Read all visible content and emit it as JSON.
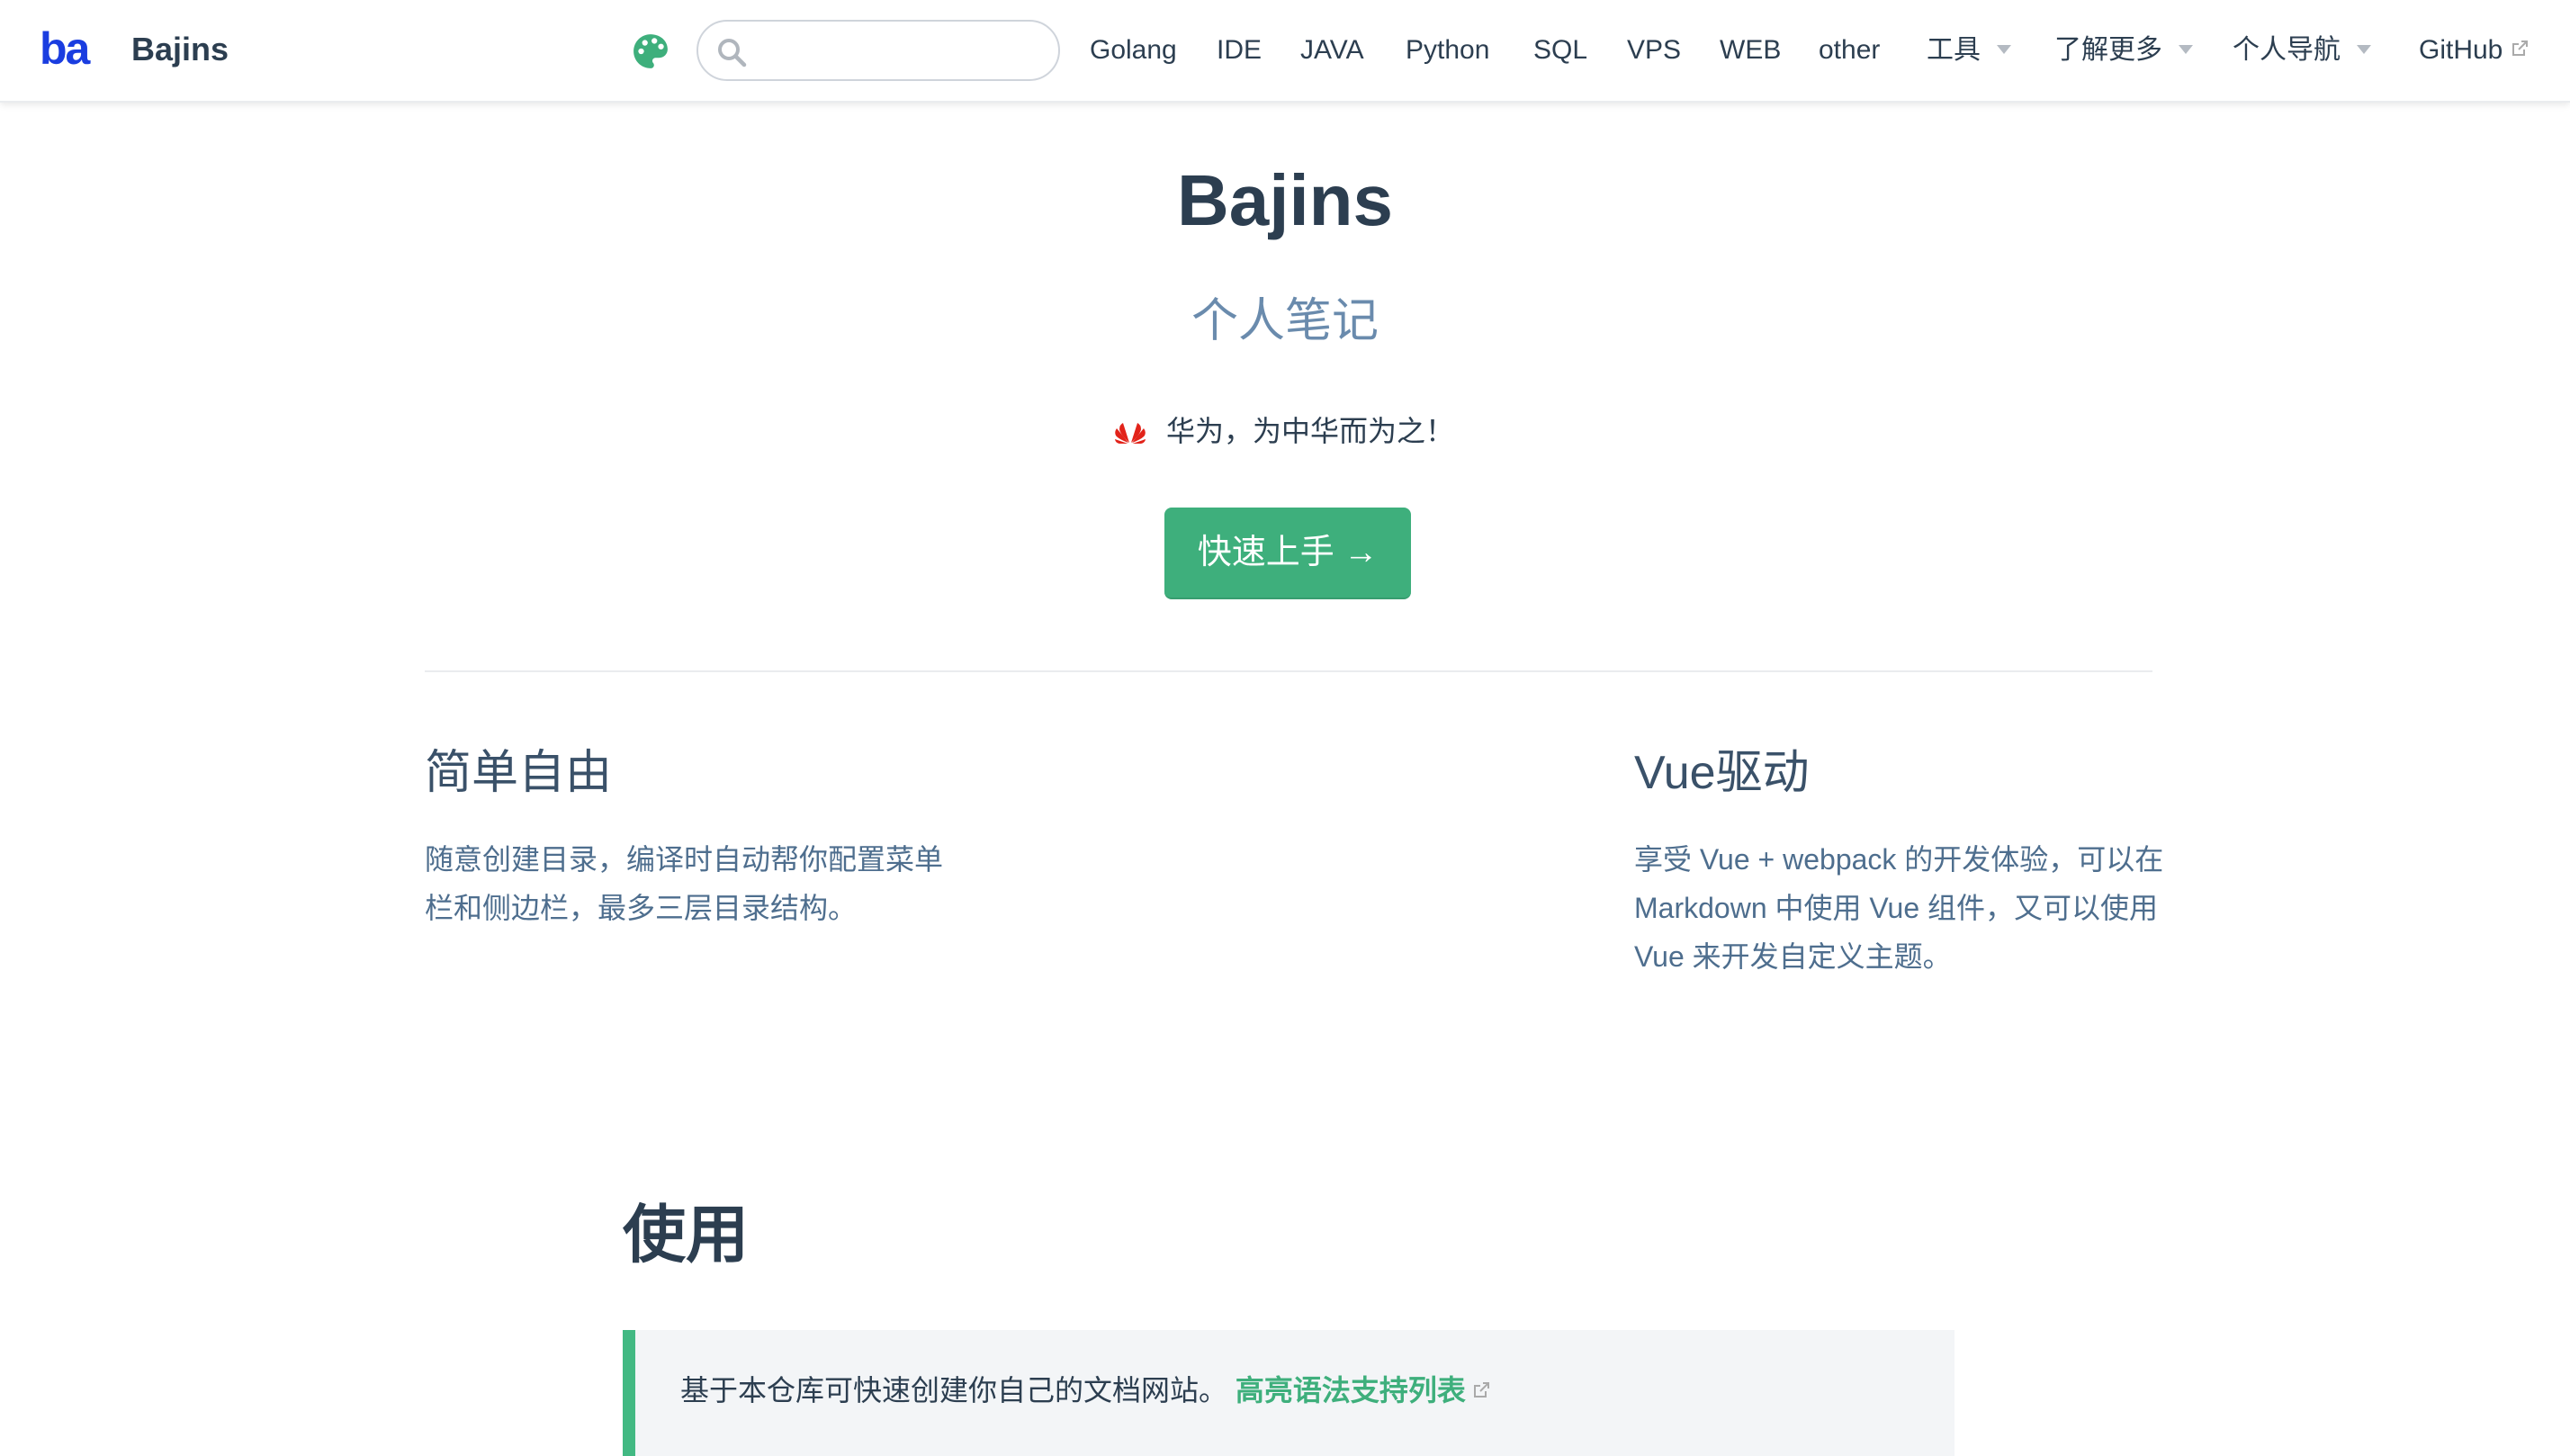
{
  "navbar": {
    "logo_text": "ba",
    "site_name": "Bajins",
    "search": {
      "placeholder": "",
      "value": ""
    },
    "links": [
      {
        "label": "Golang"
      },
      {
        "label": "IDE"
      },
      {
        "label": "JAVA"
      },
      {
        "label": "Python"
      },
      {
        "label": "SQL"
      },
      {
        "label": "VPS"
      },
      {
        "label": "WEB"
      },
      {
        "label": "other"
      },
      {
        "label": "工具",
        "dropdown": true
      },
      {
        "label": "了解更多",
        "dropdown": true
      },
      {
        "label": "个人导航",
        "dropdown": true
      },
      {
        "label": "GitHub",
        "external": true
      }
    ]
  },
  "hero": {
    "title": "Bajins",
    "description": "个人笔记",
    "motto": "华为，为中华而为之！",
    "action_text": "快速上手 →"
  },
  "features": [
    {
      "title": "简单自由",
      "details": "随意创建目录，编译时自动帮你配置菜单栏和侧边栏，最多三层目录结构。"
    },
    {
      "title": "Vue驱动",
      "details": "享受 Vue + webpack 的开发体验，可以在 Markdown 中使用 Vue 组件，又可以使用 Vue 来开发自定义主题。"
    }
  ],
  "content": {
    "section_title": "使用",
    "tip_text": "基于本仓库可快速创建你自己的文档网站。",
    "tip_link": "高亮语法支持列表"
  },
  "colors": {
    "accent": "#3eaf7c",
    "logo": "#1a3de0",
    "text": "#2c3e50",
    "description": "#6a8bad",
    "huawei": "#e2231a"
  },
  "icons": {
    "palette": "palette-icon",
    "search": "search-icon",
    "dropdown": "caret-down-icon",
    "external": "external-link-icon",
    "brand": "huawei-logo-icon"
  }
}
